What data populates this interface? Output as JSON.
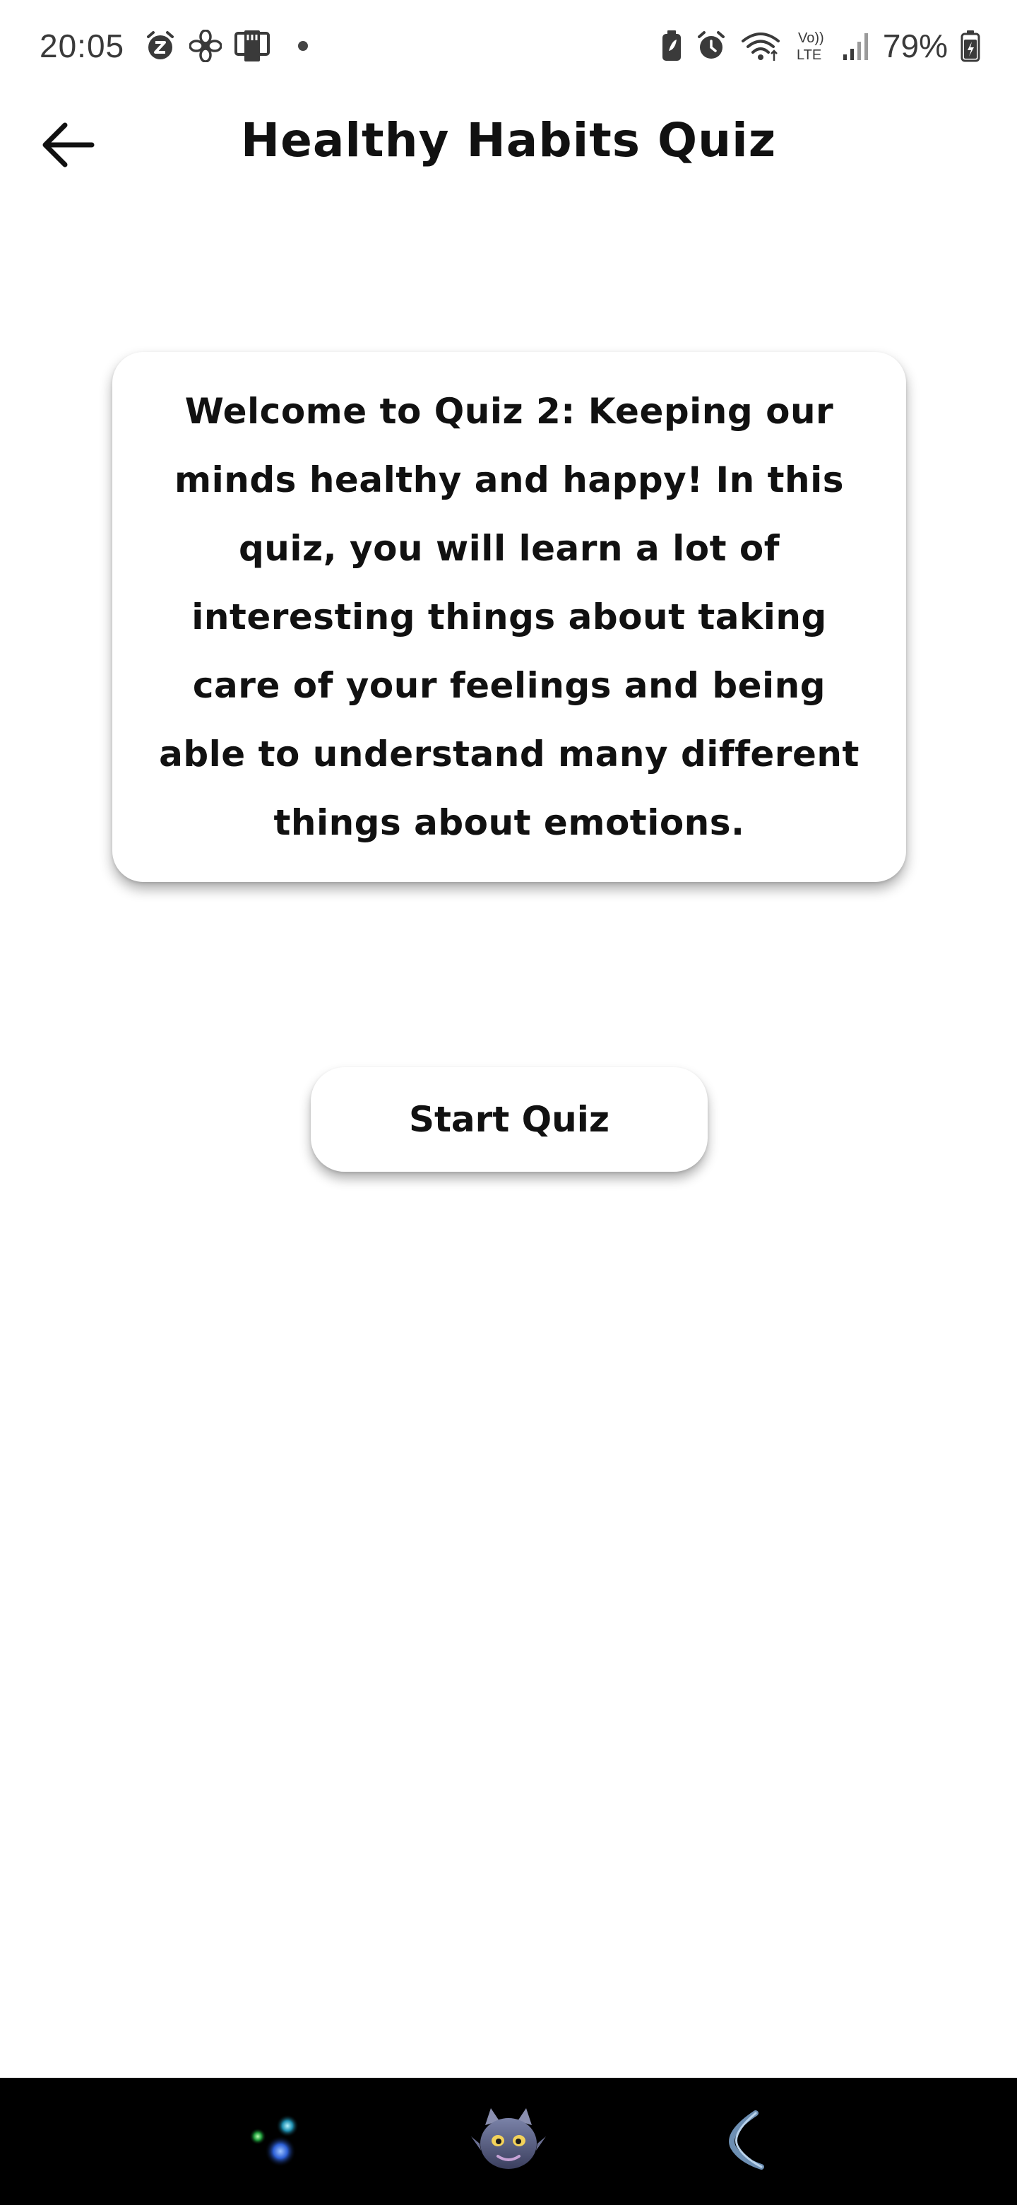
{
  "status_bar": {
    "time": "20:05",
    "left_icons": [
      "alarm-snooze-icon",
      "fan-icon",
      "sd-card-icon"
    ],
    "right_icons": [
      "battery-saver-icon",
      "alarm-icon",
      "wifi-icon",
      "volte-icon",
      "signal-icon"
    ],
    "battery_percent": "79%",
    "volte_label": "Vo))\nLTE"
  },
  "header": {
    "back_icon": "arrow-left-icon",
    "title": "Healthy Habits Quiz"
  },
  "intro_card": {
    "text": "Welcome to Quiz 2: Keeping our minds healthy and happy! In this quiz, you will learn a lot of interesting things about taking care of your feelings and being able to understand many different things about emotions."
  },
  "actions": {
    "start_label": "Start Quiz"
  },
  "nav_bar": {
    "items": [
      "sparkle-dots-icon",
      "dragon-avatar-icon",
      "back-curve-icon"
    ]
  },
  "colors": {
    "background": "#ffffff",
    "text": "#111111",
    "status_text": "#3a3a3a",
    "nav_bar": "#000000",
    "shadow": "rgba(0,0,0,0.3)"
  }
}
